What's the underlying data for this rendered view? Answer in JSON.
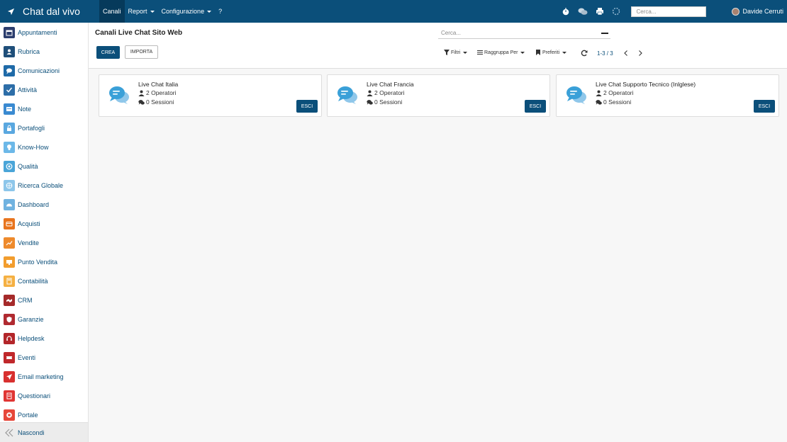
{
  "app": {
    "title": "Chat dal vivo",
    "menu": [
      {
        "label": "Canali",
        "active": true,
        "dropdown": false
      },
      {
        "label": "Report",
        "active": false,
        "dropdown": true
      },
      {
        "label": "Configurazione",
        "active": false,
        "dropdown": true
      },
      {
        "label": "?",
        "active": false,
        "dropdown": false
      }
    ],
    "search_placeholder": "Cerca...",
    "user_name": "Davide Cerruti"
  },
  "colors": {
    "brand": "#0b4f7a",
    "brand_active": "#063a5b",
    "chat_icon": "#3aa0d8"
  },
  "sidebar": {
    "items": [
      {
        "label": "Appuntamenti",
        "color": "#2c3e6e",
        "icon": "calendar-icon"
      },
      {
        "label": "Rubrica",
        "color": "#1f4f7a",
        "icon": "address-book-icon"
      },
      {
        "label": "Comunicazioni",
        "color": "#1f6aa8",
        "icon": "chat-icon"
      },
      {
        "label": "Attività",
        "color": "#2d6ea8",
        "icon": "checkbox-icon"
      },
      {
        "label": "Note",
        "color": "#3a8ad1",
        "icon": "note-icon"
      },
      {
        "label": "Portafogli",
        "color": "#5aa8e0",
        "icon": "lock-icon"
      },
      {
        "label": "Know-How",
        "color": "#6cb8e8",
        "icon": "lightbulb-icon"
      },
      {
        "label": "Qualità",
        "color": "#4aa5d8",
        "icon": "quality-icon"
      },
      {
        "label": "Ricerca Globale",
        "color": "#8dc6ea",
        "icon": "globe-icon"
      },
      {
        "label": "Dashboard",
        "color": "#6fb2e0",
        "icon": "dashboard-icon"
      },
      {
        "label": "Acquisti",
        "color": "#e8741e",
        "icon": "purchase-icon"
      },
      {
        "label": "Vendite",
        "color": "#ee8a2c",
        "icon": "sales-icon"
      },
      {
        "label": "Punto Vendita",
        "color": "#f29d2e",
        "icon": "pos-icon"
      },
      {
        "label": "Contabilità",
        "color": "#f5b042",
        "icon": "accounting-icon"
      },
      {
        "label": "CRM",
        "color": "#a52a2a",
        "icon": "handshake-icon"
      },
      {
        "label": "Garanzie",
        "color": "#b02a30",
        "icon": "shield-icon"
      },
      {
        "label": "Helpdesk",
        "color": "#b3262a",
        "icon": "headset-icon"
      },
      {
        "label": "Eventi",
        "color": "#c0282b",
        "icon": "ticket-icon"
      },
      {
        "label": "Email marketing",
        "color": "#d8302f",
        "icon": "paper-plane-icon"
      },
      {
        "label": "Questionari",
        "color": "#e03634",
        "icon": "survey-icon"
      },
      {
        "label": "Portale",
        "color": "#e6473a",
        "icon": "portal-icon"
      }
    ],
    "hide_label": "Nascondi"
  },
  "control": {
    "breadcrumb": "Canali Live Chat Sito Web",
    "create_label": "CREA",
    "import_label": "IMPORTA",
    "search_placeholder": "Cerca...",
    "filters_label": "Filtri",
    "group_by_label": "Raggruppa Per",
    "favorites_label": "Preferiti",
    "pager_value": "1-3 / 3"
  },
  "channels": [
    {
      "name": "Live Chat Italia",
      "operators": "2 Operatori",
      "sessions": "0 Sessioni",
      "button": "ESCI"
    },
    {
      "name": "Live Chat Francia",
      "operators": "2 Operatori",
      "sessions": "0 Sessioni",
      "button": "ESCI"
    },
    {
      "name": "Live Chat Supporto Tecnico (Inlglese)",
      "operators": "2 Operatori",
      "sessions": "0 Sessioni",
      "button": "ESCI"
    }
  ]
}
